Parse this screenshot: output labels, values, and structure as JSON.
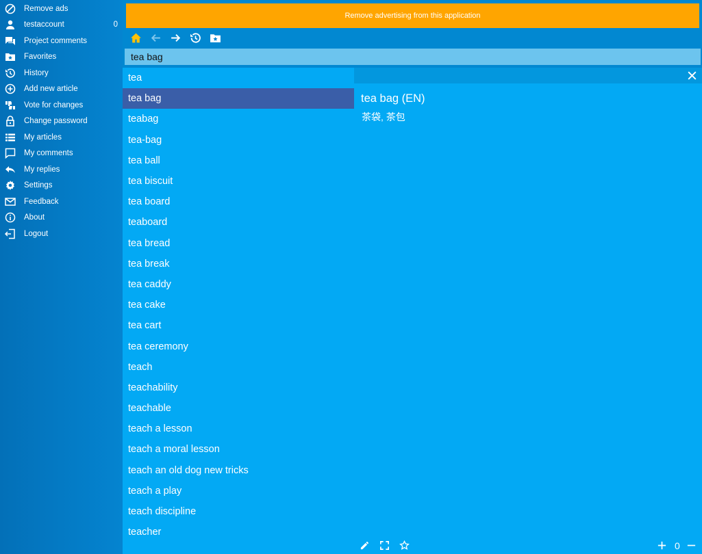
{
  "sidebar": {
    "items": [
      {
        "label": "Remove ads",
        "icon": "block-icon"
      },
      {
        "label": "testaccount",
        "icon": "user-icon",
        "count": "0"
      },
      {
        "label": "Project comments",
        "icon": "forum-icon"
      },
      {
        "label": "Favorites",
        "icon": "folder-star-icon"
      },
      {
        "label": "History",
        "icon": "history-icon"
      },
      {
        "label": "Add new article",
        "icon": "add-circle-icon"
      },
      {
        "label": "Vote for changes",
        "icon": "thumbs-icon"
      },
      {
        "label": "Change password",
        "icon": "lock-icon"
      },
      {
        "label": "My articles",
        "icon": "list-icon"
      },
      {
        "label": "My comments",
        "icon": "comment-icon"
      },
      {
        "label": "My replies",
        "icon": "reply-icon"
      },
      {
        "label": "Settings",
        "icon": "gear-icon"
      },
      {
        "label": "Feedback",
        "icon": "mail-icon"
      },
      {
        "label": "About",
        "icon": "info-icon"
      },
      {
        "label": "Logout",
        "icon": "logout-icon"
      }
    ]
  },
  "ad_banner": "Remove advertising from this application",
  "search": {
    "value": "tea bag"
  },
  "word_list": [
    "tea",
    "tea bag",
    "teabag",
    "tea-bag",
    "tea ball",
    "tea biscuit",
    "tea board",
    "teaboard",
    "tea bread",
    "tea break",
    "tea caddy",
    "tea cake",
    "tea cart",
    "tea ceremony",
    "teach",
    "teachability",
    "teachable",
    "teach a lesson",
    "teach a moral lesson",
    "teach an old dog new tricks",
    "teach a play",
    "teach discipline",
    "teacher"
  ],
  "selected_index": 1,
  "detail": {
    "term": "tea bag (EN)",
    "translation": "茶袋, 茶包",
    "zoom": "0"
  },
  "colors": {
    "accent_orange": "#ffa500",
    "home_icon": "#ffc107",
    "selected_row": "#3a5ea8",
    "panel": "#03a9f4"
  }
}
